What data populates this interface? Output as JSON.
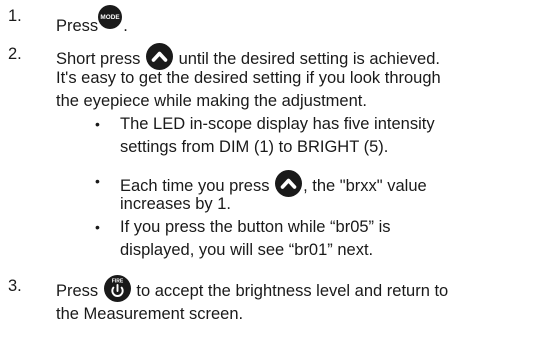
{
  "steps": [
    {
      "number": "1.",
      "text_before": "Press",
      "icon_name": "mode-button-icon",
      "icon_label": "MODE",
      "text_after": "."
    },
    {
      "number": "2.",
      "line1_before": "Short press",
      "icon_name": "up-arrow-button-icon",
      "line1_after": "until the desired setting is achieved.",
      "line2": "It's easy to get the desired setting if you look through",
      "line3": "the eyepiece while making the adjustment.",
      "bullets": [
        {
          "line1": "The LED in-scope display has five intensity",
          "line2": "settings from DIM (1) to BRIGHT (5)."
        },
        {
          "line1_before": "Each time you press",
          "icon_name": "up-arrow-button-icon",
          "line1_after": ", the \"brxx\" value",
          "line2": "increases by 1."
        },
        {
          "line1": "If you press the button while “br05” is",
          "line2": "displayed, you will see “br01” next."
        }
      ]
    },
    {
      "number": "3.",
      "line1_before": "Press",
      "icon_name": "fire-button-icon",
      "icon_label": "FIRE",
      "line1_after": "to accept the brightness level and return to",
      "line2": "the Measurement screen."
    }
  ],
  "colors": {
    "text": "#1a1a1a",
    "button": "#1a1a1a",
    "icon_fg": "#ffffff"
  }
}
